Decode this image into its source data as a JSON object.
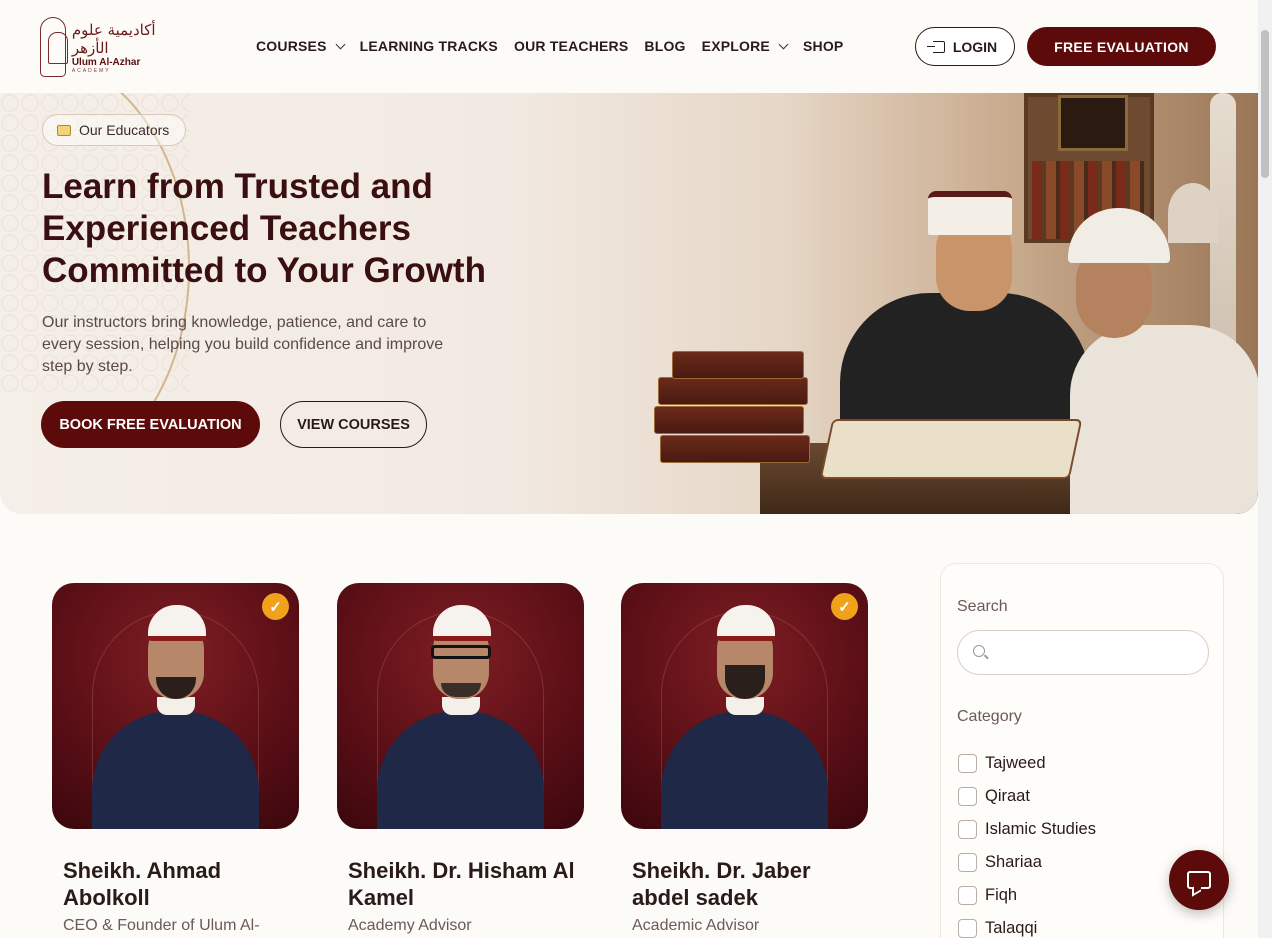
{
  "logo": {
    "arabic": "أكاديمية علوم الأزهر",
    "name": "Ulum Al-Azhar",
    "sub": "ACADEMY"
  },
  "nav": {
    "items": [
      {
        "label": "COURSES",
        "dropdown": true
      },
      {
        "label": "LEARNING TRACKS",
        "dropdown": false
      },
      {
        "label": "OUR TEACHERS",
        "dropdown": false
      },
      {
        "label": "BLOG",
        "dropdown": false
      },
      {
        "label": "EXPLORE",
        "dropdown": true
      },
      {
        "label": "SHOP",
        "dropdown": false
      }
    ]
  },
  "header": {
    "login_label": "LOGIN",
    "eval_label": "FREE EVALUATION"
  },
  "hero": {
    "badge": "Our Educators",
    "title": "Learn from Trusted and Experienced Teachers Committed to Your Growth",
    "text": "Our instructors bring knowledge, patience, and care to every session, helping you build confidence and improve step by step.",
    "book_label": "BOOK FREE EVALUATION",
    "view_label": "VIEW COURSES"
  },
  "teachers": [
    {
      "name": "Sheikh. Ahmad Abolkoll",
      "role": "CEO & Founder of Ulum Al-",
      "verified": true
    },
    {
      "name": "Sheikh. Dr. Hisham Al Kamel",
      "role": "Academy Advisor",
      "verified": false
    },
    {
      "name": "Sheikh. Dr. Jaber abdel sadek",
      "role": "Academic Advisor",
      "verified": true
    }
  ],
  "filter": {
    "search_label": "Search",
    "search_placeholder": "",
    "category_label": "Category",
    "categories": [
      "Tajweed",
      "Qiraat",
      "Islamic Studies",
      "Shariaa",
      "Fiqh",
      "Talaqqi"
    ]
  },
  "colors": {
    "brand": "#5c0a0a",
    "accent": "#f0a21a",
    "background": "#fdfbf8"
  },
  "icons": {
    "login": "login-arrow-icon",
    "badge": "chalkboard-icon",
    "verified": "verified-check-icon",
    "search": "search-icon",
    "chat": "chat-icon"
  }
}
